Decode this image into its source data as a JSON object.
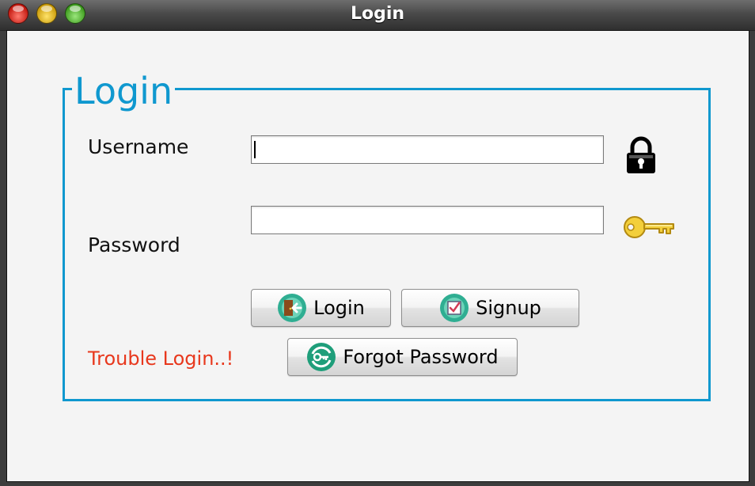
{
  "window": {
    "title": "Login"
  },
  "form": {
    "group_title": "Login",
    "username_label": "Username",
    "password_label": "Password",
    "username_value": "",
    "password_value": "",
    "login_button": "Login",
    "signup_button": "Signup",
    "forgot_button": "Forgot Password",
    "trouble_text": "Trouble Login..!"
  },
  "icons": {
    "lock": "lock-icon",
    "key": "key-icon",
    "login": "door-exit-icon",
    "signup": "checklist-icon",
    "forgot": "key-refresh-icon"
  },
  "colors": {
    "accent": "#0f98cf",
    "trouble": "#e8381d",
    "icon_teal": "#2fae92"
  }
}
